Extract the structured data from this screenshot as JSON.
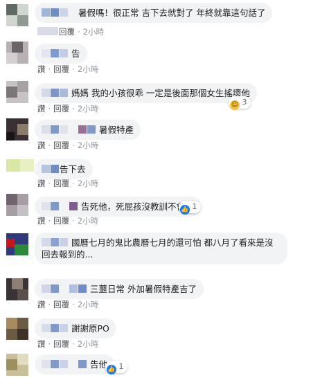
{
  "actions": {
    "like": "讚",
    "reply": "回覆",
    "time": "2小時"
  },
  "comments": [
    {
      "text": "暑假嗎！很正常 吉下去就對了 年終就靠這句話了",
      "reaction_count": ""
    },
    {
      "text": "告",
      "reaction_count": ""
    },
    {
      "text": "媽媽 我的小孩很乖 一定是後面那個女生搖壞他",
      "reaction_count": "3"
    },
    {
      "text": "暑假特產",
      "reaction_count": ""
    },
    {
      "text": "告下去",
      "reaction_count": ""
    },
    {
      "text": "告死他，死屁孩沒教訓不會怕",
      "reaction_count": "1"
    },
    {
      "text": "國曆七月的鬼比農曆七月的還可怕 都八月了看來是沒回去報到的...",
      "reaction_count": ""
    },
    {
      "text": "三蘁日常 外加暑假特產吉了",
      "reaction_count": ""
    },
    {
      "text": "謝謝原PO",
      "reaction_count": ""
    },
    {
      "text": "告他",
      "reaction_count": "1"
    }
  ],
  "colors": {
    "bubble": "#f2f3f5",
    "like_blue": "#1877f2",
    "muted": "#90949c"
  }
}
